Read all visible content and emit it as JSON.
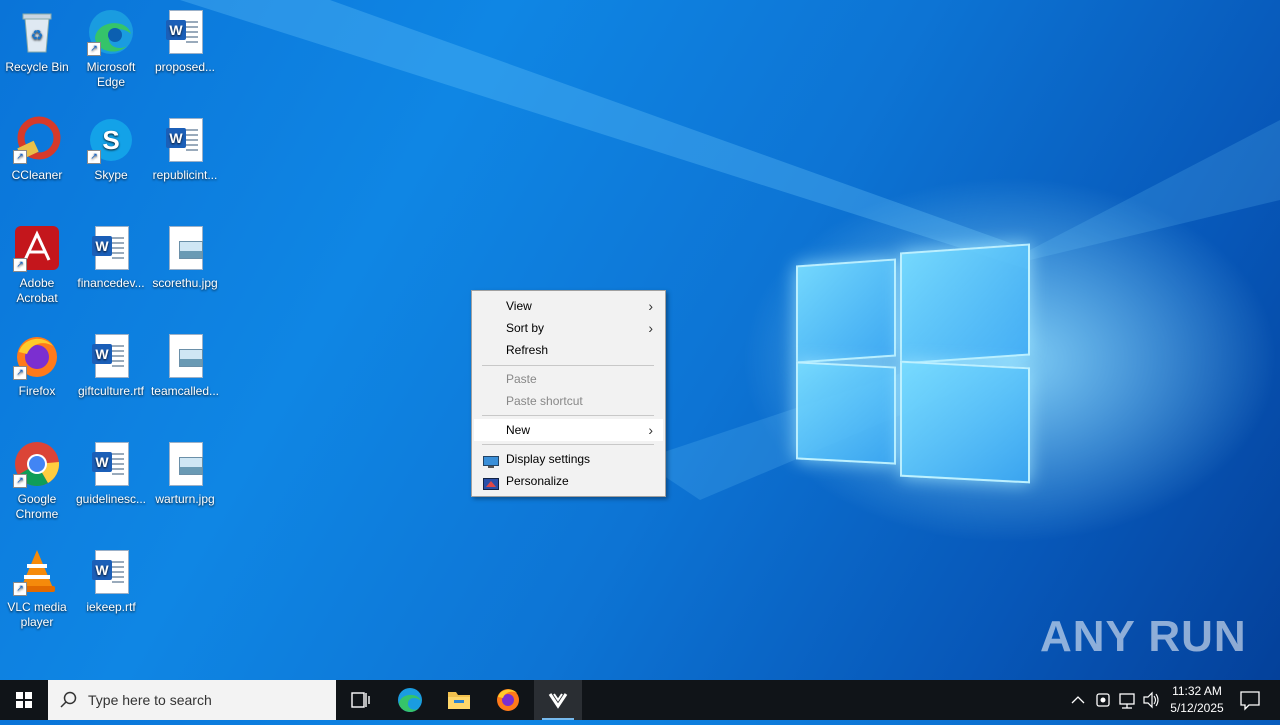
{
  "desktop": {
    "icons": [
      {
        "label": "Recycle Bin"
      },
      {
        "label": "Microsoft Edge"
      },
      {
        "label": "proposed..."
      },
      {
        "label": "CCleaner"
      },
      {
        "label": "Skype"
      },
      {
        "label": "republicint..."
      },
      {
        "label": "Adobe Acrobat"
      },
      {
        "label": "financedev..."
      },
      {
        "label": "scorethu.jpg"
      },
      {
        "label": "Firefox"
      },
      {
        "label": "giftculture.rtf"
      },
      {
        "label": "teamcalled..."
      },
      {
        "label": "Google Chrome"
      },
      {
        "label": "guidelinesc..."
      },
      {
        "label": "warturn.jpg"
      },
      {
        "label": "VLC media player"
      },
      {
        "label": "iekeep.rtf"
      }
    ]
  },
  "context_menu": {
    "items": [
      {
        "label": "View",
        "submenu": true,
        "disabled": false
      },
      {
        "label": "Sort by",
        "submenu": true,
        "disabled": false
      },
      {
        "label": "Refresh",
        "submenu": false,
        "disabled": false
      },
      {
        "label": "Paste",
        "submenu": false,
        "disabled": true
      },
      {
        "label": "Paste shortcut",
        "submenu": false,
        "disabled": true
      },
      {
        "label": "New",
        "submenu": true,
        "disabled": false,
        "highlighted": true
      },
      {
        "label": "Display settings",
        "submenu": false,
        "disabled": false,
        "icon": "display-icon"
      },
      {
        "label": "Personalize",
        "submenu": false,
        "disabled": false,
        "icon": "personalize-icon"
      }
    ]
  },
  "watermark": "ANY RUN",
  "taskbar": {
    "search_placeholder": "Type here to search",
    "pinned": [
      "task-view-icon",
      "edge-icon",
      "file-explorer-icon",
      "firefox-icon",
      "anyrun-icon"
    ],
    "clock": {
      "time": "11:32 AM",
      "date": "5/12/2025"
    }
  },
  "colors": {
    "desktop_blue": "#0a74d8",
    "taskbar": "#101418",
    "menu_bg": "#f2f2f2",
    "menu_highlight": "#ffffff"
  }
}
